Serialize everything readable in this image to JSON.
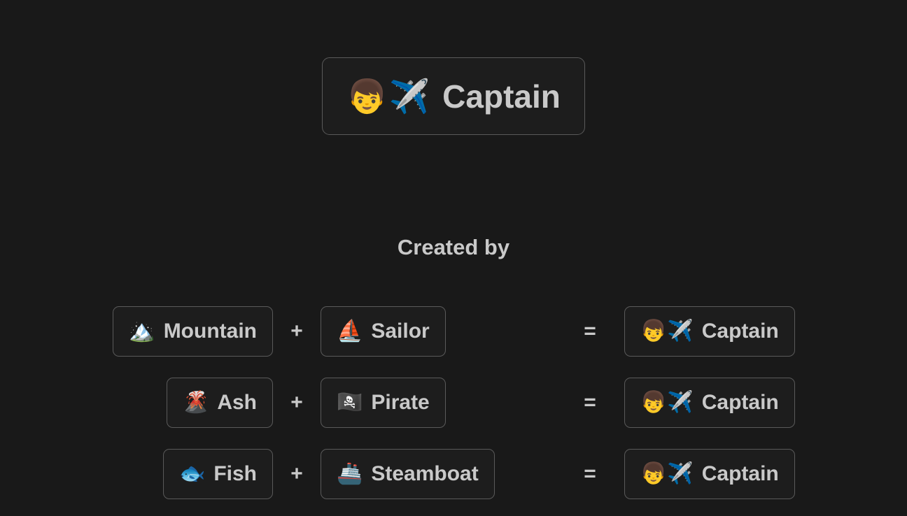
{
  "page": {
    "background_color": "#191919",
    "card_background_color": "#1d1d1d",
    "card_border_color": "#5a5a5a",
    "text_color": "#c9c9c9"
  },
  "title": {
    "emoji": "👦✈️",
    "label": "Captain"
  },
  "section": {
    "heading": "Created by"
  },
  "operators": {
    "plus": "+",
    "equals": "="
  },
  "recipes": [
    {
      "input_a": {
        "emoji": "🏔️",
        "label": "Mountain"
      },
      "input_b": {
        "emoji": "⛵",
        "label": "Sailor"
      },
      "result": {
        "emoji": "👦✈️",
        "label": "Captain"
      }
    },
    {
      "input_a": {
        "emoji": "🌋",
        "label": "Ash"
      },
      "input_b": {
        "emoji": "🏴‍☠️",
        "label": "Pirate"
      },
      "result": {
        "emoji": "👦✈️",
        "label": "Captain"
      }
    },
    {
      "input_a": {
        "emoji": "🐟",
        "label": "Fish"
      },
      "input_b": {
        "emoji": "🚢",
        "label": "Steamboat"
      },
      "result": {
        "emoji": "👦✈️",
        "label": "Captain"
      }
    }
  ]
}
